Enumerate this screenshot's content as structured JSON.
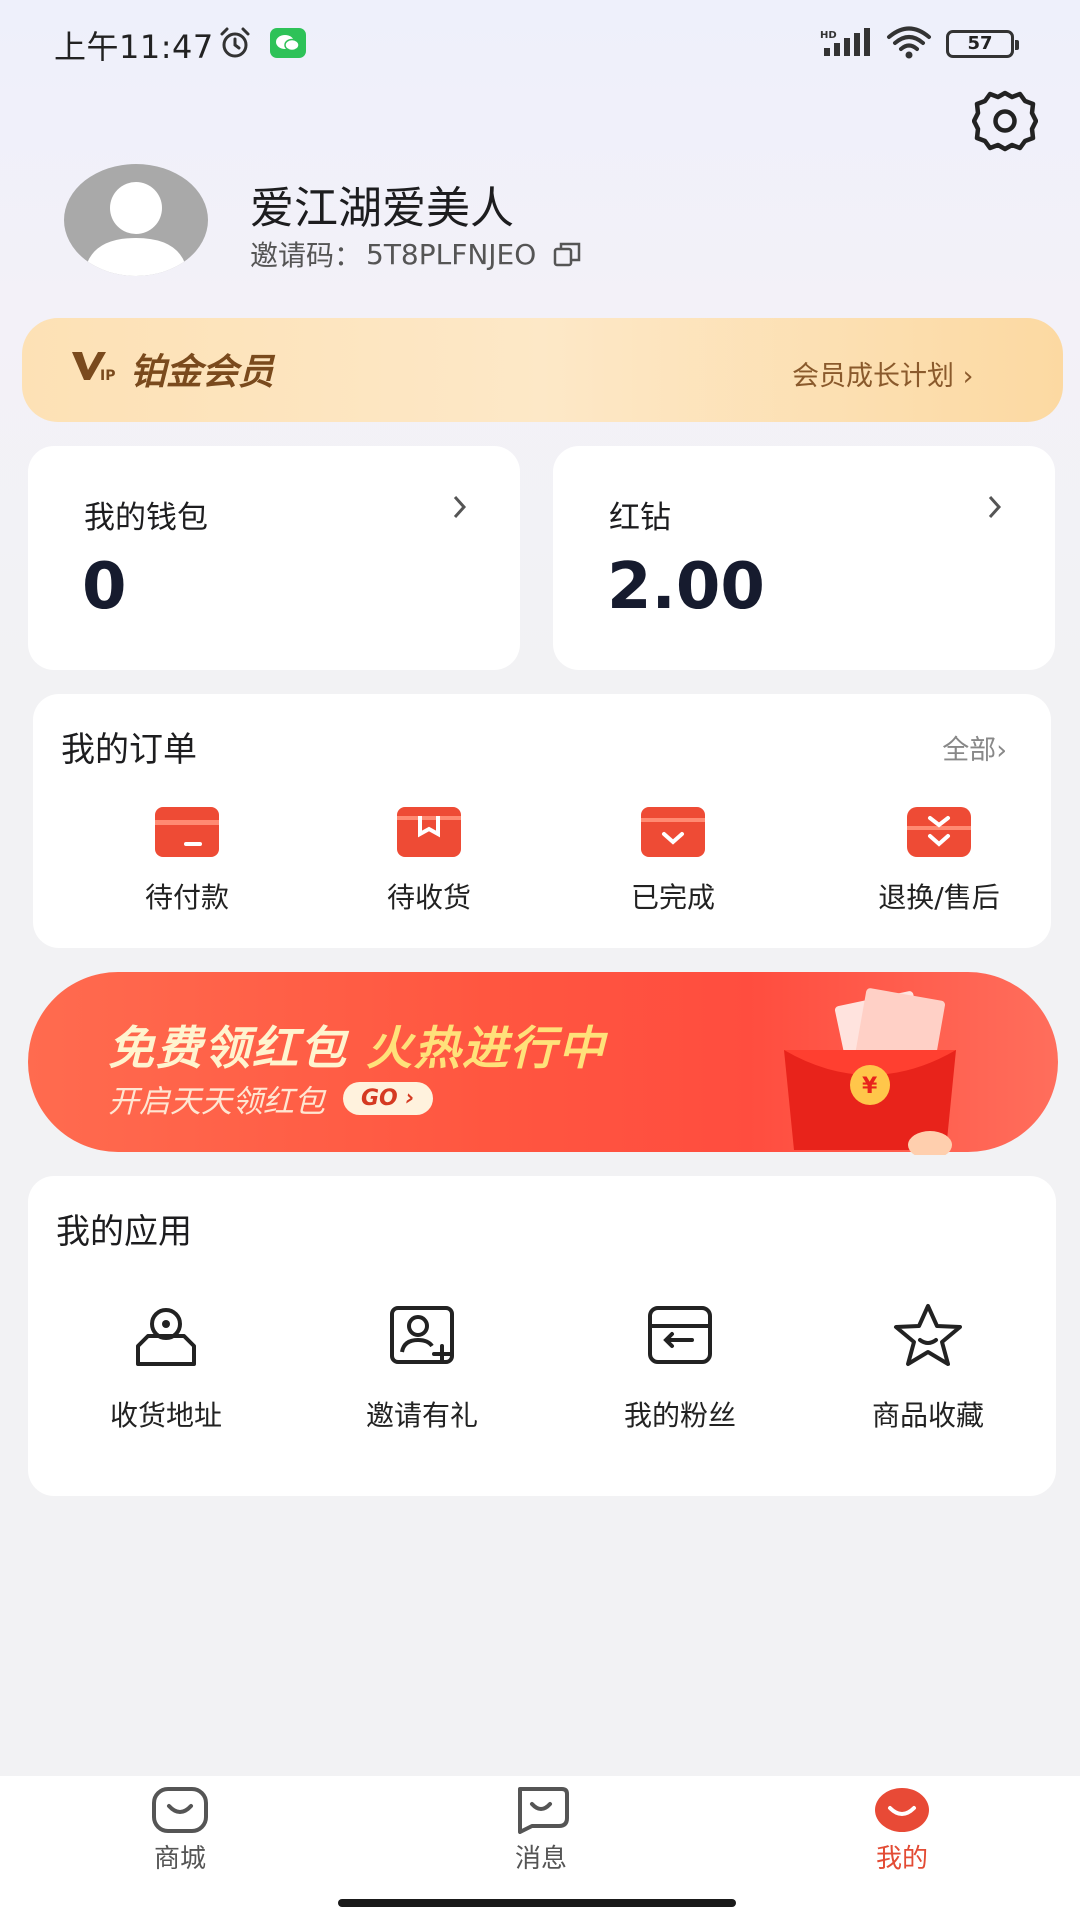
{
  "status_bar": {
    "time": "上午11:47",
    "battery": "57"
  },
  "profile": {
    "name": "爱江湖爱美人",
    "invite_label": "邀请码：",
    "invite_code": "5T8PLFNJEO"
  },
  "vip": {
    "title": "铂金会员",
    "link": "会员成长计划"
  },
  "wallet": {
    "label": "我的钱包",
    "value": "0"
  },
  "diamond": {
    "label": "红钻",
    "value": "2.00"
  },
  "orders": {
    "title": "我的订单",
    "all_label": "全部",
    "items": [
      {
        "label": "待付款",
        "icon": "wallet-card-icon"
      },
      {
        "label": "待收货",
        "icon": "package-icon"
      },
      {
        "label": "已完成",
        "icon": "box-check-icon"
      },
      {
        "label": "退换/售后",
        "icon": "return-icon"
      }
    ]
  },
  "banner": {
    "title_a": "免费领红包",
    "title_b": "火热进行中",
    "subtitle": "开启天天领红包",
    "go": "GO"
  },
  "apps": {
    "title": "我的应用",
    "items": [
      {
        "label": "收货地址",
        "icon": "location-icon"
      },
      {
        "label": "邀请有礼",
        "icon": "invite-user-icon"
      },
      {
        "label": "我的粉丝",
        "icon": "fans-box-icon"
      },
      {
        "label": "商品收藏",
        "icon": "star-icon"
      }
    ]
  },
  "tabbar": {
    "items": [
      {
        "label": "商城",
        "active": false
      },
      {
        "label": "消息",
        "active": false
      },
      {
        "label": "我的",
        "active": true
      }
    ]
  },
  "colors": {
    "accent": "#e34b34",
    "vip_gold": "#7a4a1d",
    "banner_red": "#ff5640"
  }
}
